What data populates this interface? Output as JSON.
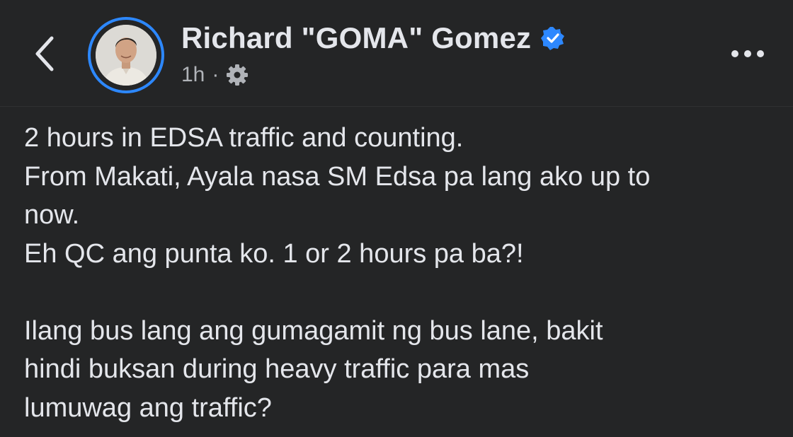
{
  "header": {
    "back_icon": "chevron-left-icon",
    "author_name": "Richard \"GOMA\" Gomez",
    "verified_badge": "verified-badge-icon",
    "time": "1h",
    "separator": "·",
    "audience_icon": "gear-icon",
    "more_icon": "more-options-icon"
  },
  "colors": {
    "background": "#242526",
    "text": "#e4e6eb",
    "secondary_text": "#b0b3b8",
    "accent": "#2d88ff"
  },
  "post": {
    "lines": [
      "2 hours in EDSA traffic and counting.",
      "From Makati, Ayala nasa SM Edsa pa lang ako up to",
      "now.",
      "Eh QC ang punta ko. 1 or 2 hours pa ba?!",
      "",
      "Ilang bus lang ang gumagamit ng bus lane, bakit",
      "hindi buksan during heavy traffic para mas",
      "lumuwag ang traffic?"
    ]
  }
}
